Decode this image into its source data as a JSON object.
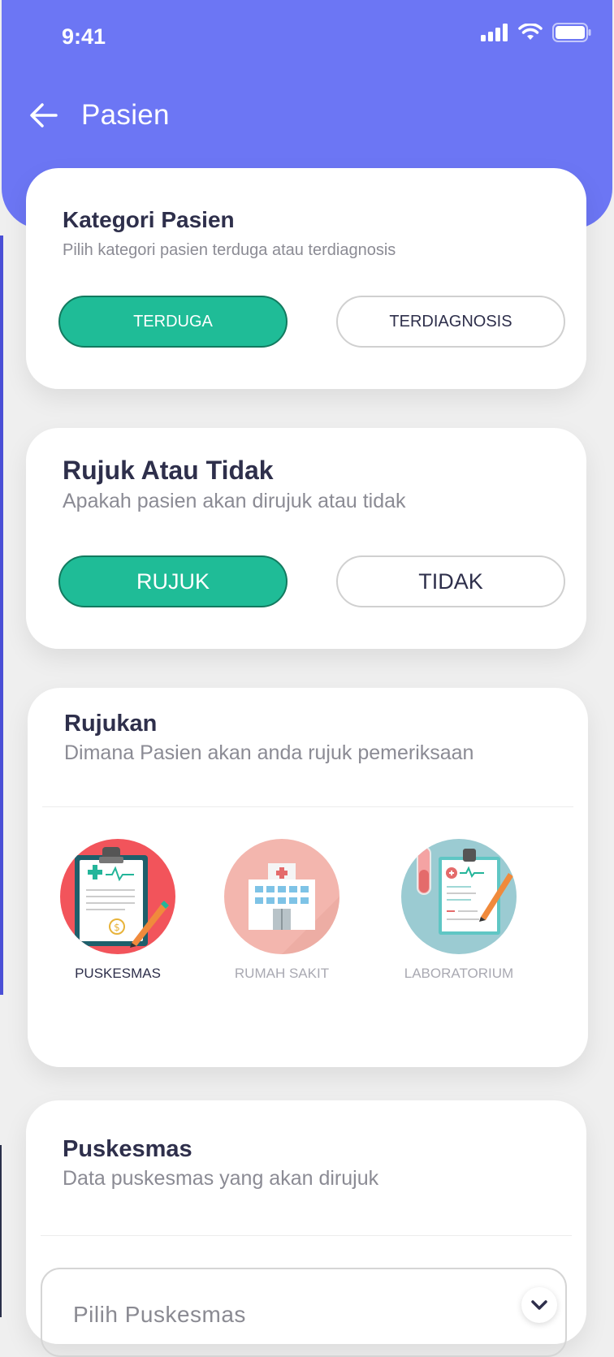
{
  "status_bar": {
    "time": "9:41"
  },
  "header": {
    "title": "Pasien"
  },
  "kategori": {
    "title": "Kategori Pasien",
    "subtitle": "Pilih kategori pasien terduga atau terdiagnosis",
    "options": [
      "TERDUGA",
      "TERDIAGNOSIS"
    ],
    "selected": "TERDUGA"
  },
  "rujuk": {
    "title": "Rujuk Atau Tidak",
    "subtitle": "Apakah pasien akan dirujuk atau tidak",
    "options": [
      "RUJUK",
      "TIDAK"
    ],
    "selected": "RUJUK"
  },
  "rujukan": {
    "title": "Rujukan",
    "subtitle": "Dimana Pasien akan anda rujuk pemeriksaan",
    "options": [
      {
        "label": "PUSKESMAS",
        "icon": "clipboard-icon",
        "selected": true
      },
      {
        "label": "RUMAH SAKIT",
        "icon": "hospital-icon",
        "selected": false
      },
      {
        "label": "LABORATORIUM",
        "icon": "lab-report-icon",
        "selected": false
      }
    ]
  },
  "puskesmas": {
    "title": "Puskesmas",
    "subtitle": "Data puskesmas yang akan dirujuk",
    "select_placeholder": "Pilih Puskesmas"
  },
  "colors": {
    "header": "#6c76f4",
    "accent": "#1fbc97",
    "text_dark": "#2e2f4b",
    "text_muted": "#8b8b94"
  }
}
